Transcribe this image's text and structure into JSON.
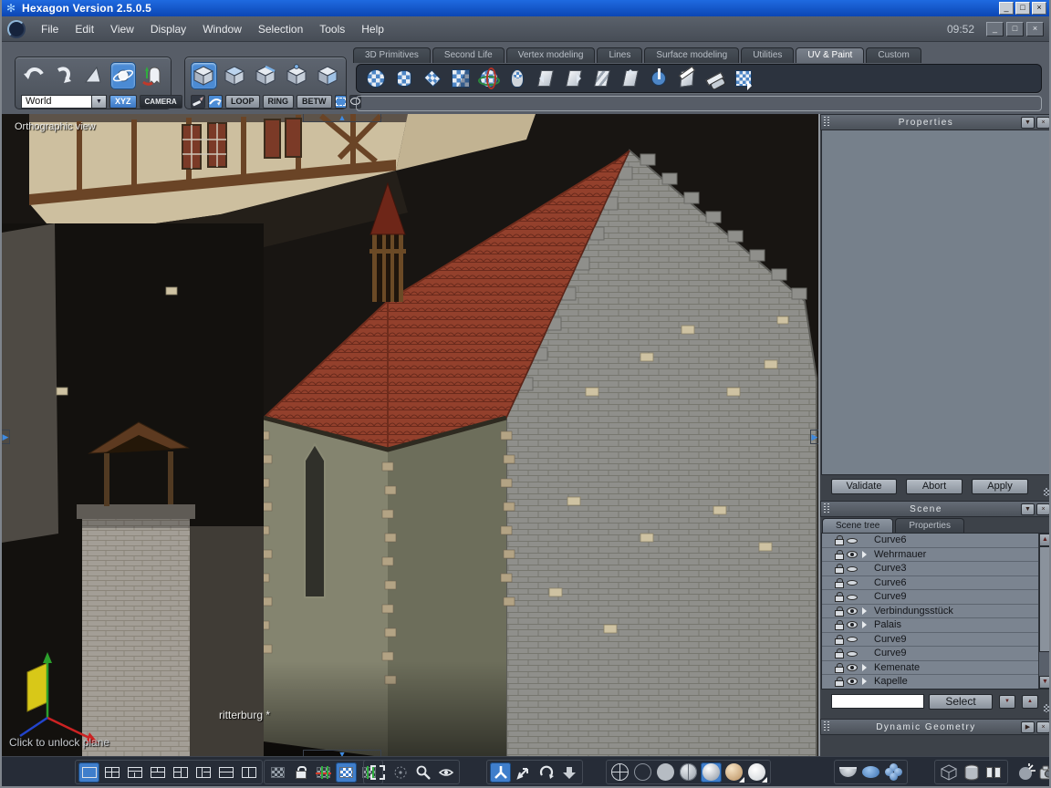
{
  "window": {
    "title": "Hexagon Version 2.5.0.5",
    "clock": "09:52"
  },
  "menu": {
    "items": [
      {
        "label": "File"
      },
      {
        "label": "Edit"
      },
      {
        "label": "View"
      },
      {
        "label": "Display"
      },
      {
        "label": "Window"
      },
      {
        "label": "Selection"
      },
      {
        "label": "Tools"
      },
      {
        "label": "Help"
      }
    ]
  },
  "tabs": [
    {
      "label": "3D Primitives",
      "active": false
    },
    {
      "label": "Second Life",
      "active": false
    },
    {
      "label": "Vertex modeling",
      "active": false
    },
    {
      "label": "Lines",
      "active": false
    },
    {
      "label": "Surface modeling",
      "active": false
    },
    {
      "label": "Utilities",
      "active": false
    },
    {
      "label": "UV & Paint",
      "active": true
    },
    {
      "label": "Custom",
      "active": false
    }
  ],
  "left_tools": {
    "world_label": "World",
    "xyz_label": "XYZ",
    "camera_label": "CAMERA",
    "loop_label": "LOOP",
    "ring_label": "RING",
    "betw_label": "BETW"
  },
  "viewport": {
    "view_label": "Orthographic view",
    "scene_name": "ritterburg *",
    "hint": "Click to unlock plane"
  },
  "properties_panel": {
    "title": "Properties",
    "validate_label": "Validate",
    "abort_label": "Abort",
    "apply_label": "Apply"
  },
  "scene_panel": {
    "title": "Scene",
    "tabs": [
      {
        "label": "Scene tree",
        "active": true
      },
      {
        "label": "Properties",
        "active": false
      }
    ],
    "items": [
      {
        "label": "Curve6",
        "eye": "closed",
        "expandable": false
      },
      {
        "label": "Wehrmauer",
        "eye": "open",
        "expandable": true
      },
      {
        "label": "Curve3",
        "eye": "closed",
        "expandable": false
      },
      {
        "label": "Curve6",
        "eye": "closed",
        "expandable": false
      },
      {
        "label": "Curve9",
        "eye": "closed",
        "expandable": false
      },
      {
        "label": "Verbindungsstück",
        "eye": "open",
        "expandable": true
      },
      {
        "label": "Palais",
        "eye": "open",
        "expandable": true
      },
      {
        "label": "Curve9",
        "eye": "closed",
        "expandable": false
      },
      {
        "label": "Curve9",
        "eye": "closed",
        "expandable": false
      },
      {
        "label": "Kemenate",
        "eye": "open",
        "expandable": true
      },
      {
        "label": "Kapelle",
        "eye": "open",
        "expandable": true
      }
    ],
    "search_value": "",
    "select_label": "Select"
  },
  "dynamic_geometry": {
    "title": "Dynamic Geometry"
  },
  "icons": {
    "minimize": "_",
    "maximize": "□",
    "close": "×",
    "chevron_down": "▼",
    "chevron_up": "▲",
    "play_right": "▶",
    "scroll_up": "▲",
    "scroll_down": "▼"
  },
  "colors": {
    "titlebar_blue": "#1558c8",
    "selection_blue": "#3f7ecb",
    "panel_gray": "#76808b",
    "toolbar_dark": "#2c333e"
  }
}
